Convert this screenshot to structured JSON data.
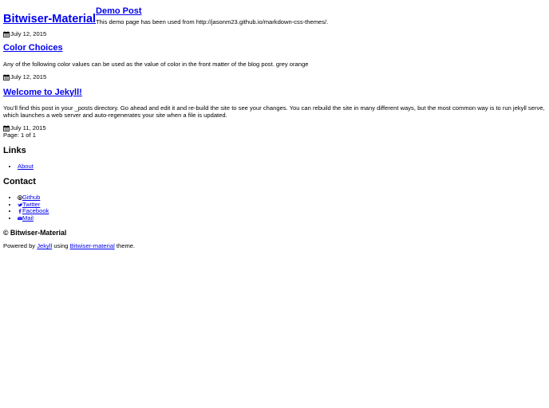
{
  "site": {
    "title": "Bitwiser-Material"
  },
  "posts": [
    {
      "title": "Demo Post",
      "excerpt": "This demo page has been used from http://jasonm23.github.io/markdown-css-themes/.",
      "date": "July 12, 2015"
    },
    {
      "title": "Color Choices",
      "excerpt": "Any of the following color values can be used as the value of color in the front matter of the blog post. grey orange",
      "date": "July 12, 2015"
    },
    {
      "title": "Welcome to Jekyll!",
      "excerpt": "You’ll find this post in your _posts directory. Go ahead and edit it and re-build the site to see your changes. You can rebuild the site in many different ways, but the most common way is to run jekyll serve, which launches a web server and auto-regenerates your site when a file is updated.",
      "date": "July 11, 2015"
    }
  ],
  "pagination": {
    "text": "Page: 1 of 1"
  },
  "links": {
    "title": "Links",
    "items": [
      {
        "label": "About"
      }
    ]
  },
  "contact": {
    "title": "Contact",
    "items": [
      {
        "label": "Github",
        "icon": "github-icon"
      },
      {
        "label": "Twitter",
        "icon": "twitter-icon"
      },
      {
        "label": "Facebook",
        "icon": "facebook-icon"
      },
      {
        "label": "Mail",
        "icon": "mail-icon"
      }
    ]
  },
  "footer": {
    "copyright": "© Bitwiser-Material",
    "powered_prefix": "Powered by",
    "jekyll_link": "Jekyll",
    "using": "using",
    "theme_link": "Bitwiser-material",
    "suffix": "theme."
  },
  "colors": {
    "link": "#0000ee",
    "text": "#000000",
    "background": "#ffffff"
  }
}
